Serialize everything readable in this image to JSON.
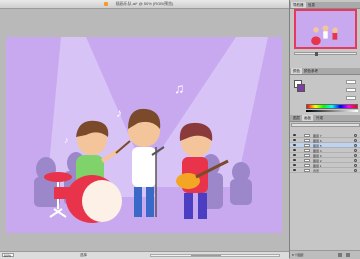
{
  "window": {
    "title": "插画乐队.ai* @ 50% (RGB/预览)"
  },
  "status": {
    "zoom": "50%",
    "label": "选择"
  },
  "panels": {
    "navigator": {
      "tabs": [
        "导航器",
        "信息"
      ]
    },
    "color": {
      "tabs": [
        "颜色",
        "颜色参考"
      ]
    },
    "layers": {
      "tabs": [
        "图层",
        "画板",
        "外观"
      ],
      "rows": [
        "图层 7",
        "图层 6",
        "图层 5",
        "图层 4",
        "图层 3",
        "图层 2",
        "图层 1",
        "背景"
      ],
      "footer": "8 个图层"
    }
  },
  "art": {
    "notes": [
      "♪",
      "♫",
      "♪"
    ]
  },
  "colors": {
    "artboard_bg": "#c8a9f0",
    "crowd": "#9b87c9",
    "drum_red": "#e8334a",
    "accent": "#e53a5a"
  }
}
